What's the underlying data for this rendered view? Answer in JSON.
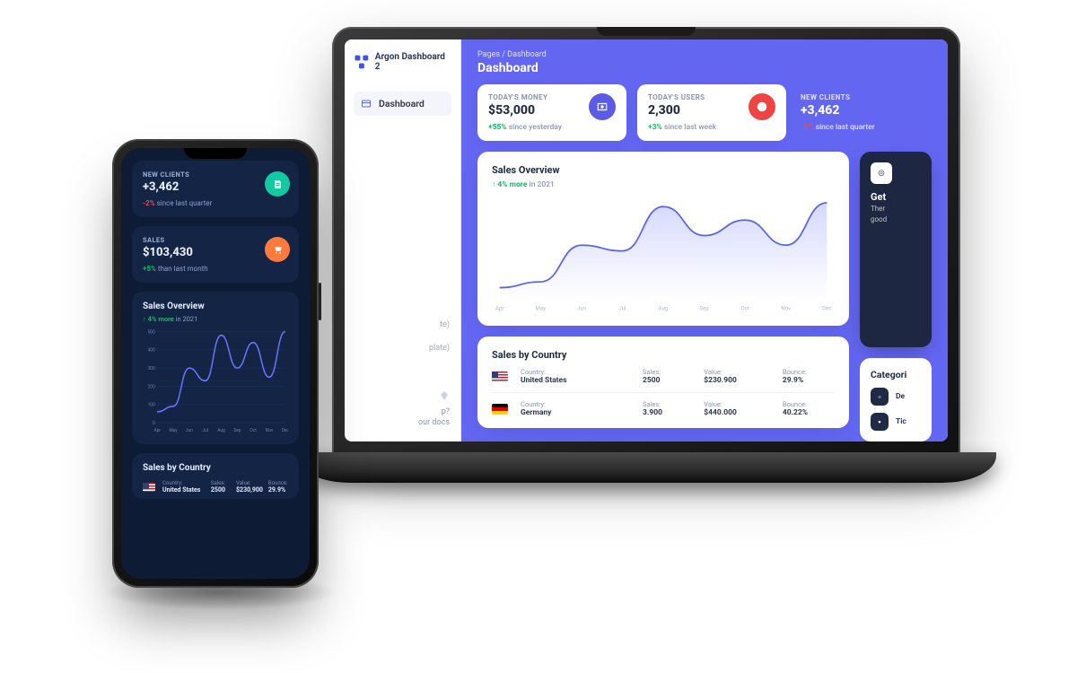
{
  "brand": "Argon Dashboard 2",
  "sidebar": {
    "items": [
      {
        "label": "Dashboard"
      }
    ],
    "help_suffix": "our docs",
    "template_hint_1": "te)",
    "template_hint_2": "plate)",
    "help_prefix": "p?"
  },
  "header": {
    "breadcrumb": "Pages / Dashboard",
    "title": "Dashboard"
  },
  "stats": [
    {
      "label": "TODAY'S MONEY",
      "value": "$53,000",
      "delta": "+55%",
      "delta_dir": "up",
      "tail": "since yesterday",
      "badge": "bg-indigo",
      "icon": "money"
    },
    {
      "label": "TODAY'S USERS",
      "value": "2,300",
      "delta": "+3%",
      "delta_dir": "up",
      "tail": "since last week",
      "badge": "bg-red",
      "icon": "users"
    },
    {
      "label": "NEW CLIENTS",
      "value": "+3,462",
      "delta": "-2%",
      "delta_dir": "down",
      "tail": "since last quarter",
      "badge": "",
      "icon": ""
    }
  ],
  "sales_overview": {
    "title": "Sales Overview",
    "sub_pre": "↑ ",
    "sub_pct": "4% more",
    "sub_post": " in 2021"
  },
  "chart_data": {
    "type": "line",
    "title": "Sales Overview",
    "categories": [
      "Apr",
      "May",
      "Jun",
      "Jul",
      "Aug",
      "Sep",
      "Oct",
      "Nov",
      "Dec"
    ],
    "values": [
      60,
      90,
      280,
      250,
      480,
      330,
      410,
      280,
      500
    ],
    "ylim": [
      0,
      500
    ],
    "xlabel": "",
    "ylabel": ""
  },
  "phone_chart_data": {
    "type": "line",
    "title": "Sales Overview",
    "categories": [
      "Apr",
      "May",
      "Jun",
      "Jul",
      "Aug",
      "Sep",
      "Oct",
      "Nov",
      "Dec"
    ],
    "values": [
      60,
      90,
      300,
      230,
      480,
      300,
      440,
      250,
      500
    ],
    "yticks": [
      0,
      100,
      200,
      300,
      400,
      500
    ],
    "ylim": [
      0,
      500
    ]
  },
  "sales_by_country": {
    "title": "Sales by Country",
    "cols": {
      "c1": "Country:",
      "c2": "Sales:",
      "c3": "Value:",
      "c4": "Bounce:"
    },
    "rows": [
      {
        "flag": "us",
        "country": "United States",
        "sales": "2500",
        "value": "$230.900",
        "bounce": "29.9%"
      },
      {
        "flag": "de",
        "country": "Germany",
        "sales": "3.900",
        "value": "$440.000",
        "bounce": "40.22%"
      }
    ]
  },
  "promo": {
    "title": "Get",
    "line1": "Ther",
    "line2": "good"
  },
  "categories": {
    "title": "Categori",
    "rows": [
      {
        "icon": "device",
        "label": "De"
      },
      {
        "icon": "ticket",
        "label": "Tic"
      }
    ]
  },
  "phone": {
    "cards": [
      {
        "label": "NEW CLIENTS",
        "value": "+3,462",
        "delta": "-2%",
        "delta_dir": "down",
        "tail": "since last quarter",
        "badge": "bg-teal",
        "icon": "clients"
      },
      {
        "label": "SALES",
        "value": "$103,430",
        "delta": "+5%",
        "delta_dir": "up",
        "tail": "than last month",
        "badge": "bg-orange",
        "icon": "cart"
      }
    ],
    "sales_by_country": {
      "title": "Sales by Country",
      "cols": {
        "c1": "Country:",
        "c2": "Sales:",
        "c3": "Value:",
        "c4": "Bounce:"
      },
      "row": {
        "flag": "us",
        "country": "United States",
        "sales": "2500",
        "value": "$230,900",
        "bounce": "29.9%"
      }
    }
  }
}
